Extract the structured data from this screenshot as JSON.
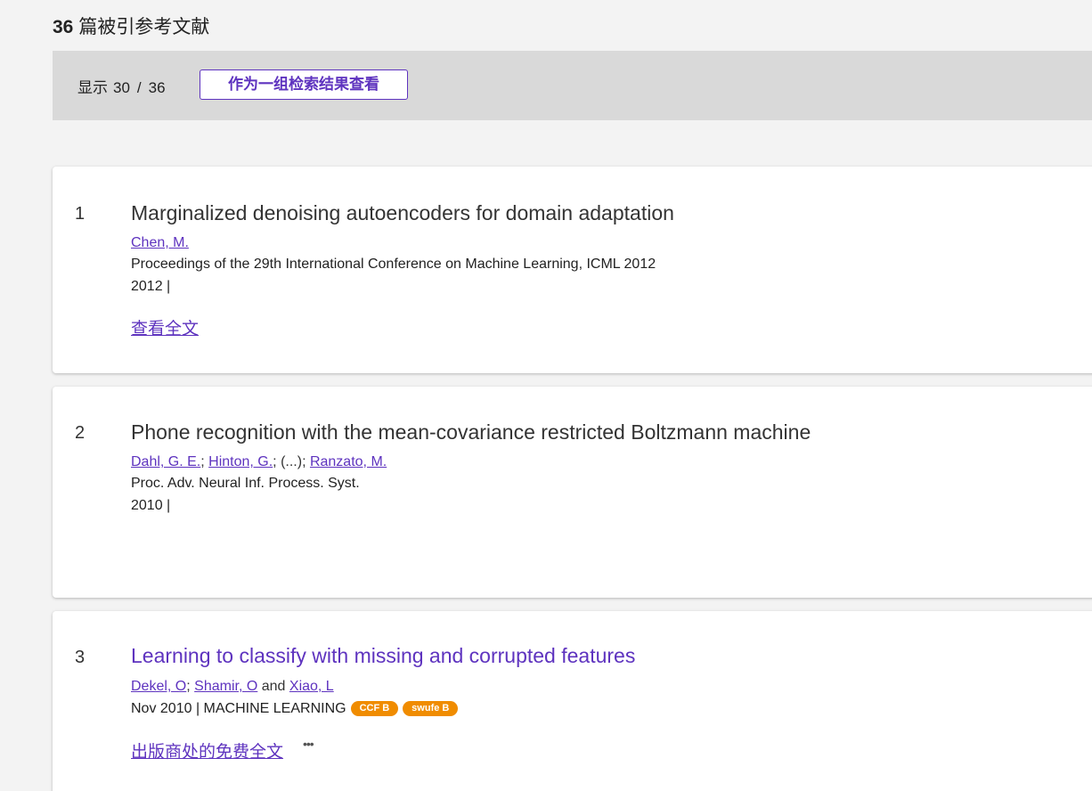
{
  "header": {
    "count": "36",
    "title": "篇被引参考文献"
  },
  "toolbar": {
    "showing_label": "显示",
    "shown": "30",
    "separator": "/",
    "total": "36",
    "view_button_label": "作为一组检索结果查看"
  },
  "records": [
    {
      "index": "1",
      "title": "Marginalized denoising autoencoders for domain adaptation",
      "authors": [
        "Chen, M."
      ],
      "source": "Proceedings of the 29th International Conference on Machine Learning, ICML 2012",
      "year": "2012 |",
      "link_label": "查看全文"
    },
    {
      "index": "2",
      "title": "Phone recognition with the mean-covariance restricted Boltzmann machine",
      "authors": [
        "Dahl, G. E.",
        "Hinton, G.",
        "Ranzato, M."
      ],
      "authors_ellipsis": "(...)",
      "source": "Proc. Adv. Neural Inf. Process. Syst.",
      "year": "2010 |"
    },
    {
      "index": "3",
      "title": "Learning to classify with missing and corrupted features",
      "authors": [
        "Dekel, O",
        "Shamir, O",
        "Xiao, L"
      ],
      "authors_joiner": "and",
      "date_source": "Nov 2010 | MACHINE LEARNING",
      "badges": [
        "CCF B",
        "swufe B"
      ],
      "link_label": "出版商处的免费全文",
      "more_icon": "•••"
    }
  ],
  "colors": {
    "accent": "#5e33bf",
    "badge": "#f08c00",
    "toolbar_bg": "#d9d9d9"
  }
}
